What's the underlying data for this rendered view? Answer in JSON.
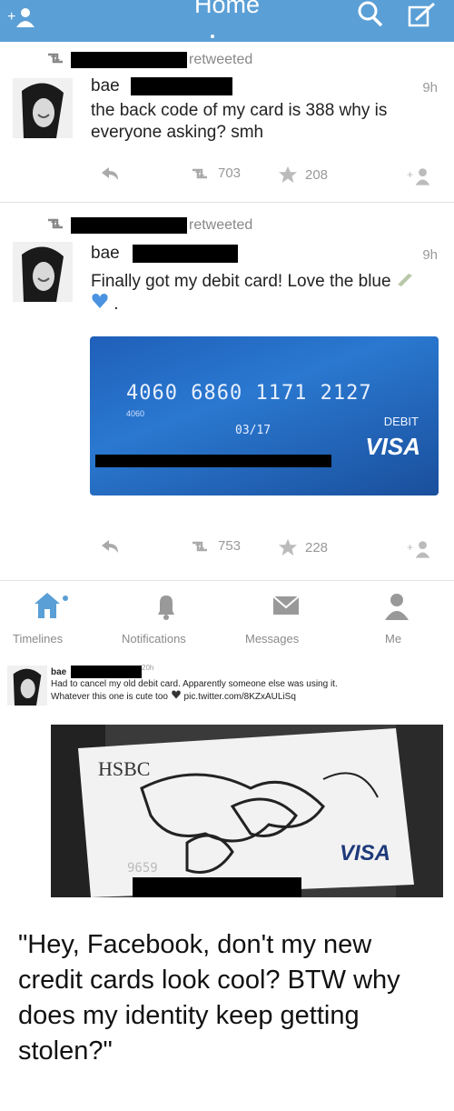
{
  "header": {
    "title": "Home",
    "icons": [
      "add-user-icon",
      "search-icon",
      "compose-icon"
    ],
    "bar_color": "#5a9fd6"
  },
  "tweets": [
    {
      "retweeted_label": "retweeted",
      "name": "bae",
      "time": "9h",
      "text": "the back code of my card is 388 why is everyone asking? smh",
      "retweets": "703",
      "favorites": "208"
    },
    {
      "retweeted_label": "retweeted",
      "name": "bae",
      "time": "9h",
      "text": "Finally got my debit card! Love the blue",
      "retweets": "753",
      "favorites": "228",
      "card": {
        "number": "4060 6860 1171 2127",
        "sub_number": "4060",
        "expiry": "03/17",
        "type": "DEBIT",
        "brand": "VISA",
        "color": "#2a78d0"
      }
    }
  ],
  "bottom_nav": [
    {
      "label": "Timelines",
      "icon": "home-icon"
    },
    {
      "label": "Notifications",
      "icon": "bell-icon"
    },
    {
      "label": "Messages",
      "icon": "envelope-icon"
    },
    {
      "label": "Me",
      "icon": "person-icon"
    }
  ],
  "screenshot_tweet": {
    "name": "bae",
    "time": "20h",
    "text_line1": "Had to cancel my old debit card. Apparently someone else was using it.",
    "text_line2": "Whatever this one is cute too",
    "link": "pic.twitter.com/8KZxAULiSq",
    "photo": {
      "bank": "HSBC",
      "brand": "VISA",
      "digits": "9659"
    }
  },
  "caption": "\"Hey, Facebook, don't my new credit cards look cool? BTW why does my identity keep getting stolen?\""
}
